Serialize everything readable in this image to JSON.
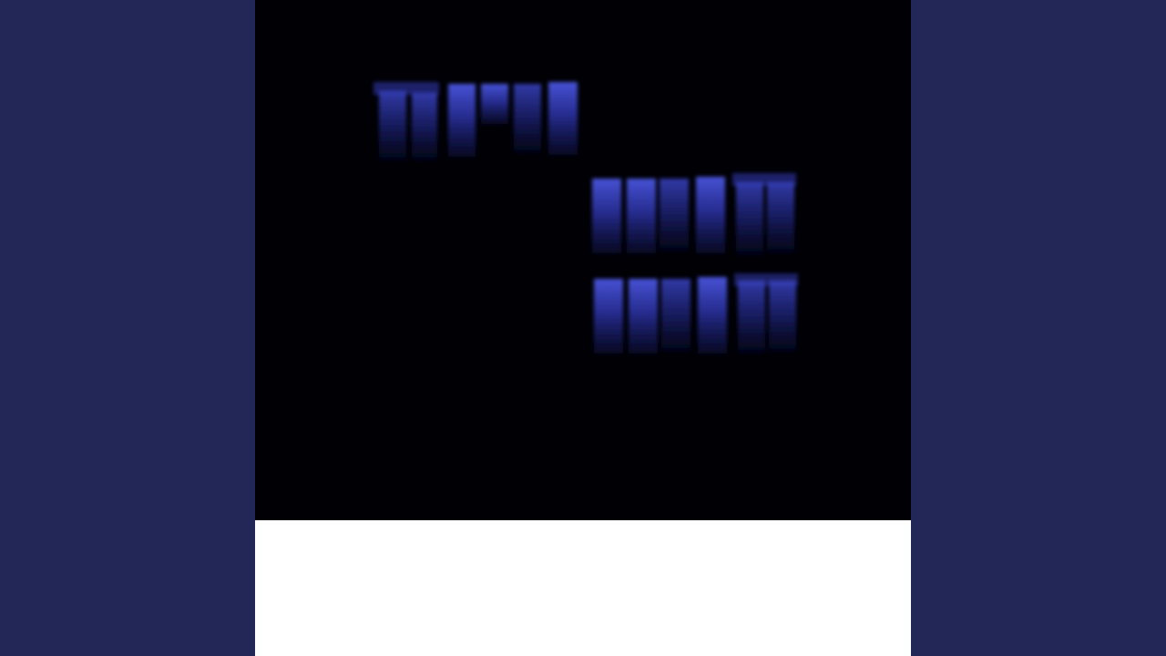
{
  "colors": {
    "background": "#222757",
    "photo_background": "#000005",
    "strip": "#ffffff",
    "band_bright": "#4b57e0",
    "band_mid": "#2d34a8",
    "band_dark": "#0b0e3a"
  },
  "image": {
    "subject": "dark-photo-with-blue-vertical-bands",
    "groups": [
      {
        "name": "upper-left-band-row",
        "count": 6
      },
      {
        "name": "middle-right-band-row",
        "count": 6
      },
      {
        "name": "lower-right-band-row",
        "count": 6
      }
    ]
  }
}
